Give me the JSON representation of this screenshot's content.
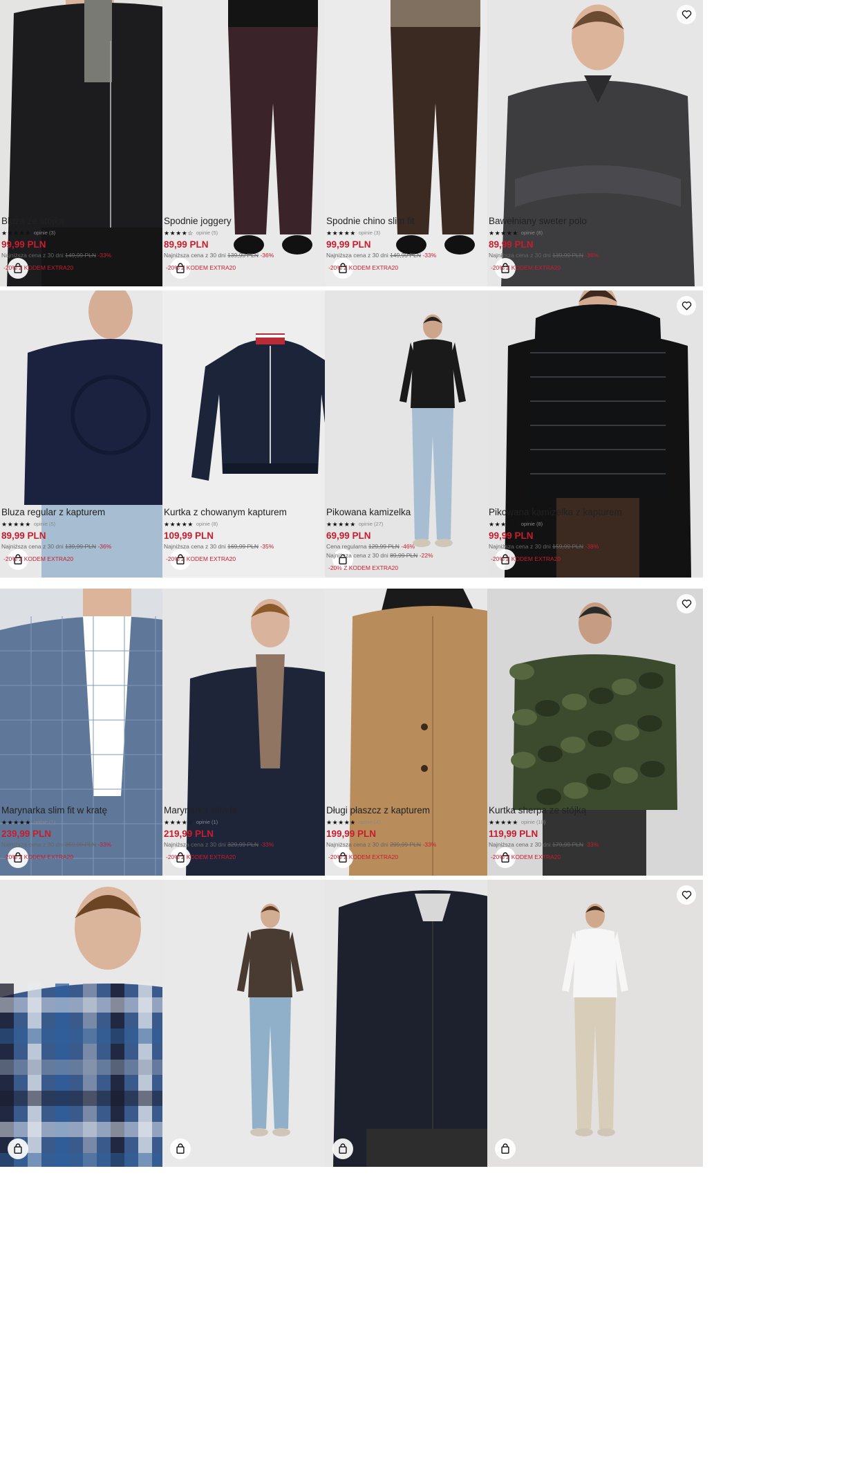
{
  "products": [
    {
      "name": "Bluza ze stójką",
      "stars": "★★★★★",
      "reviews": "opinie (3)",
      "price": "99,99 PLN",
      "price_notes": [
        {
          "label": "Najniższa cena z 30 dni",
          "old": "149,99 PLN",
          "discount": "-33%"
        }
      ],
      "promo": "-20% Z KODEM EXTRA20",
      "photo": "man-black-zip-jacket"
    },
    {
      "name": "Spodnie joggery",
      "stars": "★★★★☆",
      "reviews": "opinie (5)",
      "price": "89,99 PLN",
      "price_notes": [
        {
          "label": "Najniższa cena z 30 dni",
          "old": "139,99 PLN",
          "discount": "-36%"
        }
      ],
      "promo": "-20% Z KODEM EXTRA20",
      "photo": "man-burgundy-joggers"
    },
    {
      "name": "Spodnie chino slim fit",
      "stars": "★★★★★",
      "reviews": "opinie (3)",
      "price": "99,99 PLN",
      "price_notes": [
        {
          "label": "Najniższa cena z 30 dni",
          "old": "149,99 PLN",
          "discount": "-33%"
        }
      ],
      "promo": "-20% Z KODEM EXTRA20",
      "photo": "man-brown-chinos"
    },
    {
      "name": "Bawełniany sweter polo",
      "stars": "★★★★★",
      "reviews": "opinie (8)",
      "price": "89,99 PLN",
      "price_notes": [
        {
          "label": "Najniższa cena z 30 dni",
          "old": "139,99 PLN",
          "discount": "-36%"
        }
      ],
      "promo": "-20% Z KODEM EXTRA20",
      "photo": "man-grey-polo-sweater"
    },
    {
      "name": "Bluza regular z kapturem",
      "stars": "★★★★★",
      "reviews": "opinie (5)",
      "price": "89,99 PLN",
      "price_notes": [
        {
          "label": "Najniższa cena z 30 dni",
          "old": "139,99 PLN",
          "discount": "-36%"
        }
      ],
      "promo": "-20% Z KODEM EXTRA20",
      "photo": "man-navy-hoodie"
    },
    {
      "name": "Kurtka z chowanym kapturem",
      "stars": "★★★★★",
      "reviews": "opinie (8)",
      "price": "109,99 PLN",
      "price_notes": [
        {
          "label": "Najniższa cena z 30 dni",
          "old": "169,99 PLN",
          "discount": "-35%"
        }
      ],
      "promo": "-20% Z KODEM EXTRA20",
      "photo": "navy-bomber-jacket-flatlay"
    },
    {
      "name": "Pikowana kamizelka",
      "stars": "★★★★★",
      "reviews": "opinie (27)",
      "price": "69,99 PLN",
      "price_notes": [
        {
          "label": "Cena regularna",
          "old": "129,99 PLN",
          "discount": "-46%"
        },
        {
          "label": "Najniższa cena z 30 dni",
          "old": "89,99 PLN",
          "discount": "-22%"
        }
      ],
      "promo": "-20% Z KODEM EXTRA20",
      "photo": "man-black-quilted-vest"
    },
    {
      "name": "Pikowana kamizelka z kapturem",
      "stars": "★★★★★",
      "reviews": "opinie (8)",
      "price": "99,99 PLN",
      "price_notes": [
        {
          "label": "Najniższa cena z 30 dni",
          "old": "159,99 PLN",
          "discount": "-38%"
        }
      ],
      "promo": "-20% Z KODEM EXTRA20",
      "photo": "man-glossy-puffer-vest"
    },
    {
      "name": "Marynarka slim fit w kratę",
      "stars": "★★★★★",
      "reviews": "opinie (1)",
      "price": "239,99 PLN",
      "price_notes": [
        {
          "label": "Najniższa cena z 30 dni",
          "old": "359,99 PLN",
          "discount": "-33%"
        }
      ],
      "promo": "-20% Z KODEM EXTRA20",
      "photo": "man-blue-check-blazer"
    },
    {
      "name": "Marynarka slim fit",
      "stars": "★★★★☆",
      "reviews": "opinie (1)",
      "price": "219,99 PLN",
      "price_notes": [
        {
          "label": "Najniższa cena z 30 dni",
          "old": "329,99 PLN",
          "discount": "-33%"
        }
      ],
      "promo": "-20% Z KODEM EXTRA20",
      "photo": "man-navy-blazer"
    },
    {
      "name": "Długi płaszcz z kapturem",
      "stars": "★★★★★",
      "reviews": "opinie (4)",
      "price": "199,99 PLN",
      "price_notes": [
        {
          "label": "Najniższa cena z 30 dni",
          "old": "299,99 PLN",
          "discount": "-33%"
        }
      ],
      "promo": "-20% Z KODEM EXTRA20",
      "photo": "man-camel-coat"
    },
    {
      "name": "Kurtka sherpa ze stójką",
      "stars": "★★★★★",
      "reviews": "opinie (10)",
      "price": "119,99 PLN",
      "price_notes": [
        {
          "label": "Najniższa cena z 30 dni",
          "old": "179,99 PLN",
          "discount": "-33%"
        }
      ],
      "promo": "-20% Z KODEM EXTRA20",
      "photo": "man-camo-sherpa-jacket"
    },
    {
      "photo": "man-blue-check-overshirt"
    },
    {
      "photo": "man-brown-suede-jacket"
    },
    {
      "photo": "man-navy-bomber"
    },
    {
      "photo": "man-white-tee-cargo-pants"
    }
  ],
  "icons": {
    "favorite": "heart-icon",
    "add_to_cart": "shopping-bag-icon"
  },
  "colors": {
    "price": "#c71d2d",
    "text": "#222222"
  }
}
